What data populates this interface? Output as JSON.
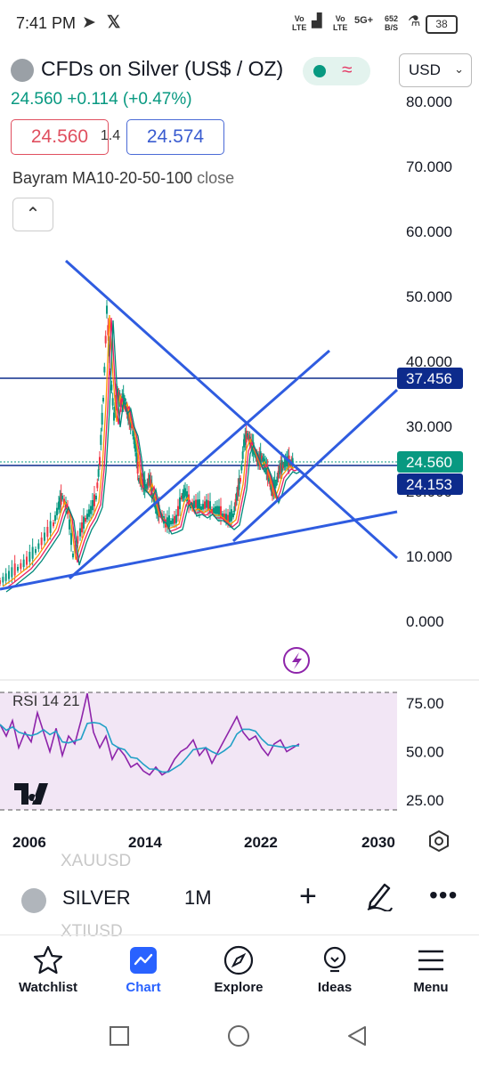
{
  "status_bar": {
    "time": "7:41 PM",
    "sig1": "Vo\nLTE",
    "sig2": "Vo\nLTE",
    "net": "5G+",
    "speed": "652\nB/S",
    "battery": "38"
  },
  "header": {
    "title": "CFDs on Silver (US$ / OZ)",
    "currency": "USD",
    "last": "24.560",
    "change": "+0.114",
    "change_pct": "(+0.47%)",
    "bid": "24.560",
    "spread": "1.4",
    "ask": "24.574",
    "indicator_name": "Bayram MA10-20-50-100",
    "indicator_action": "close"
  },
  "chart_data": {
    "type": "candlestick",
    "price_axis_ticks": [
      "80.000",
      "70.000",
      "60.000",
      "50.000",
      "40.000",
      "30.000",
      "20.000",
      "10.000",
      "0.000"
    ],
    "price_labels": [
      {
        "text": "37.456",
        "color": "#0d2b8c",
        "kind": "horizontal-line"
      },
      {
        "text": "24.560",
        "color": "#089981",
        "kind": "last-price"
      },
      {
        "text": "24.153",
        "color": "#0d2b8c",
        "kind": "horizontal-line"
      }
    ],
    "time_axis_ticks": [
      "2006",
      "2014",
      "2022",
      "2030"
    ],
    "rsi": {
      "label": "RSI 14 21",
      "ticks": [
        "75.00",
        "50.00",
        "25.00"
      ],
      "upper": 80,
      "lower": 20
    },
    "colors": {
      "line": "#2f5ce0",
      "hline": "#0d2b8c",
      "rsi": "#8e24aa",
      "rsi_ma": "#21a0c6",
      "up": "#089981",
      "down": "#f23645"
    }
  },
  "toolbar": {
    "ghost_top": "XAUUSD",
    "symbol": "SILVER",
    "interval": "1M",
    "ghost_bottom": "XTIUSD"
  },
  "nav": {
    "items": [
      {
        "label": "Watchlist"
      },
      {
        "label": "Chart"
      },
      {
        "label": "Explore"
      },
      {
        "label": "Ideas"
      },
      {
        "label": "Menu"
      }
    ]
  }
}
